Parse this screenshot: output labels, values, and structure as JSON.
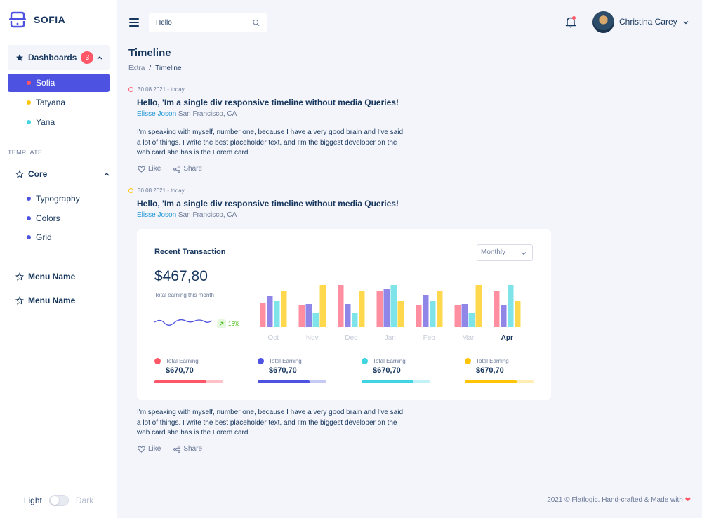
{
  "brand": {
    "name": "SOFIA"
  },
  "sidebar": {
    "dashboards": {
      "label": "Dashboards",
      "badge": "3"
    },
    "dash_items": [
      {
        "label": "Sofia",
        "color": "#ff5668"
      },
      {
        "label": "Tatyana",
        "color": "#ffc405"
      },
      {
        "label": "Yana",
        "color": "#41d5e2"
      }
    ],
    "template_label": "TEMPLATE",
    "core": {
      "label": "Core"
    },
    "core_items": [
      {
        "label": "Typography",
        "color": "#4d53e0"
      },
      {
        "label": "Colors",
        "color": "#4d53e0"
      },
      {
        "label": "Grid",
        "color": "#4d53e0"
      }
    ],
    "menu_items": [
      "Menu Name",
      "Menu Name"
    ],
    "theme": {
      "light": "Light",
      "dark": "Dark"
    }
  },
  "header": {
    "search_value": "Hello",
    "user_name": "Christina Carey"
  },
  "page": {
    "title": "Timeline",
    "breadcrumb": [
      "Extra",
      "Timeline"
    ]
  },
  "timeline": [
    {
      "date": "30.08.2021 - today",
      "heading": "Hello, 'Im a single div responsive timeline without media Queries!",
      "author": "Elisse Joson",
      "location": "San Francisco, CA",
      "text": "I'm speaking with myself, number one, because I have a very good brain and I've said a lot of things. I write the best placeholder text, and I'm the biggest developer on the web card she has is the Lorem card.",
      "like": "Like",
      "share": "Share"
    },
    {
      "date": "30.08.2021 - today",
      "heading": "Hello, 'Im a single div responsive timeline without media Queries!",
      "author": "Elisse Joson",
      "location": "San Francisco, CA",
      "text": "I'm speaking with myself, number one, because I have a very good brain and I've said a lot of things. I write the best placeholder text, and I'm the biggest developer on the web card she has is the Lorem card.",
      "like": "Like",
      "share": "Share"
    }
  ],
  "card": {
    "title": "Recent Transaction",
    "period": "Monthly",
    "amount": "$467,80",
    "amount_label": "Total earning this month",
    "trend": "16%",
    "legend": [
      {
        "label": "Total Earning",
        "value": "$670,70",
        "color": "#ff5668",
        "track": "#ffc1c8",
        "progress": 0.75
      },
      {
        "label": "Total Earning",
        "value": "$670,70",
        "color": "#4d53e0",
        "track": "#c7c9f5",
        "progress": 0.75
      },
      {
        "label": "Total Earning",
        "value": "$670,70",
        "color": "#41d5e2",
        "track": "#c4f1f5",
        "progress": 0.75
      },
      {
        "label": "Total Earning",
        "value": "$670,70",
        "color": "#ffc405",
        "track": "#ffedb3",
        "progress": 0.75
      }
    ]
  },
  "chart_data": {
    "type": "bar",
    "categories": [
      "Oct",
      "Nov",
      "Dec",
      "Jan",
      "Feb",
      "Mar",
      "Apr"
    ],
    "active_category": "Apr",
    "ylim": [
      0,
      60
    ],
    "series": [
      {
        "color": "#ff8fa0",
        "values": [
          34,
          31,
          60,
          52,
          32,
          31,
          52
        ]
      },
      {
        "color": "#8f86e8",
        "values": [
          44,
          33,
          33,
          54,
          45,
          33,
          31
        ]
      },
      {
        "color": "#7fe3ea",
        "values": [
          37,
          20,
          20,
          60,
          37,
          20,
          60
        ]
      },
      {
        "color": "#ffd84d",
        "values": [
          52,
          60,
          52,
          37,
          52,
          60,
          37
        ]
      }
    ],
    "grid": false
  },
  "footer": {
    "text": "2021 © Flatlogic. Hand-crafted & Made with"
  }
}
